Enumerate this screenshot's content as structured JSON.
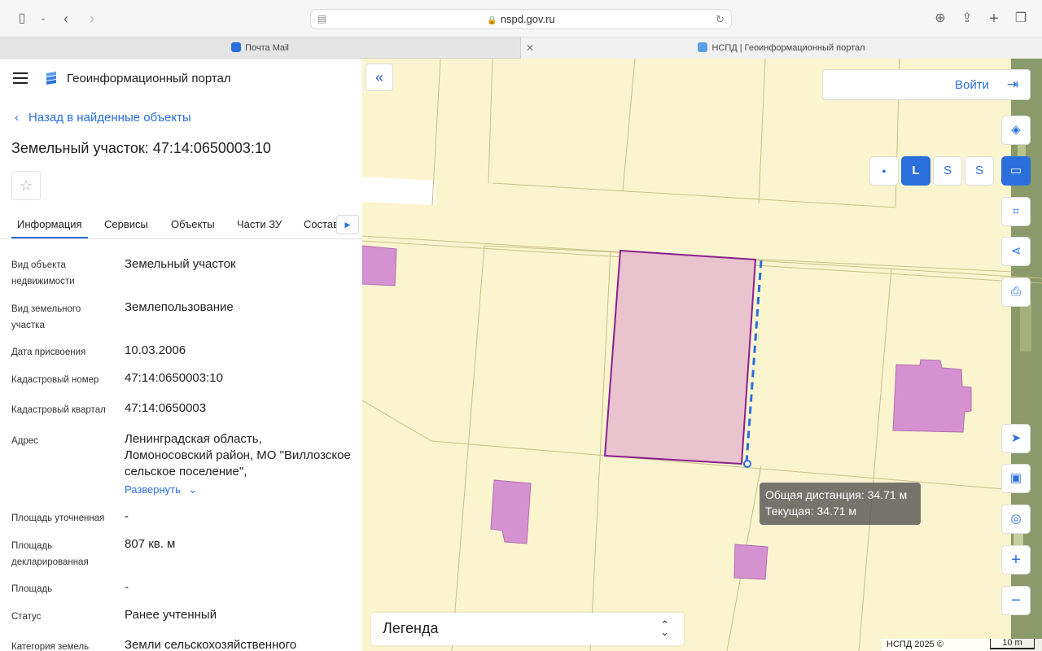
{
  "browser": {
    "url": "nspd.gov.ru",
    "tabs": [
      {
        "label": "Почта Mail"
      },
      {
        "label": "НСПД | Геоинформационный портал"
      }
    ]
  },
  "header": {
    "portal_title": "Геоинформационный портал"
  },
  "panel": {
    "back_label": "Назад в найденные объекты",
    "title": "Земельный участок: 47:14:0650003:10",
    "tabs": [
      {
        "label": "Информация"
      },
      {
        "label": "Сервисы"
      },
      {
        "label": "Объекты"
      },
      {
        "label": "Части ЗУ"
      },
      {
        "label": "Состав"
      }
    ],
    "rows": [
      {
        "label": "Вид объекта недвижимости",
        "value": "Земельный участок"
      },
      {
        "label": "Вид земельного участка",
        "value": "Землепользование"
      },
      {
        "label": "Дата присвоения",
        "value": "10.03.2006"
      },
      {
        "label": "Кадастровый номер",
        "value": "47:14:0650003:10"
      },
      {
        "label": "Кадастровый квартал",
        "value": "47:14:0650003"
      },
      {
        "label": "Адрес",
        "value": "Ленинградская область, Ломоносовский район, МО \"Виллозское сельское поселение\","
      },
      {
        "label": "Площадь уточненная",
        "value": "-"
      },
      {
        "label": "Площадь декларированная",
        "value": "807 кв. м"
      },
      {
        "label": "Площадь",
        "value": "-"
      },
      {
        "label": "Статус",
        "value": "Ранее учтенный"
      },
      {
        "label": "Категория земель",
        "value": "Земли сельскохозяйственного"
      }
    ],
    "expand_label": "Развернуть"
  },
  "map": {
    "login_label": "Войти",
    "tooltip": {
      "total": "Общая дистанция: 34.71 м",
      "current": "Текущая: 34.71 м"
    },
    "legend_label": "Легенда",
    "copyright": "НСПД 2025 ©",
    "scale_label": "10 m",
    "measure_tools": [
      {
        "icon": "point-icon",
        "glyph": "●"
      },
      {
        "icon": "line-measure-icon",
        "glyph": "L"
      },
      {
        "icon": "area-measure-icon",
        "glyph": "S"
      },
      {
        "icon": "circle-measure-icon",
        "glyph": "S"
      }
    ],
    "side_tools": [
      {
        "icon": "layers-icon",
        "glyph": "◈"
      },
      {
        "icon": "ruler-icon",
        "glyph": "▭"
      },
      {
        "icon": "area-select-icon",
        "glyph": "⌗"
      },
      {
        "icon": "share-icon",
        "glyph": "⋖"
      },
      {
        "icon": "print-icon",
        "glyph": "⎙"
      },
      {
        "icon": "locate-icon",
        "glyph": "➤"
      },
      {
        "icon": "minimap-icon",
        "glyph": "▣"
      },
      {
        "icon": "geo-search-icon",
        "glyph": "◎"
      },
      {
        "icon": "zoom-in-icon",
        "glyph": "+"
      },
      {
        "icon": "zoom-out-icon",
        "glyph": "−"
      }
    ]
  },
  "colors": {
    "accent": "#2a6fdb",
    "map_bg": "#fbf5cf",
    "parcel_fill": "#e9c3cd",
    "parcel_border": "#8b1f8f",
    "building": "#d592d0"
  }
}
